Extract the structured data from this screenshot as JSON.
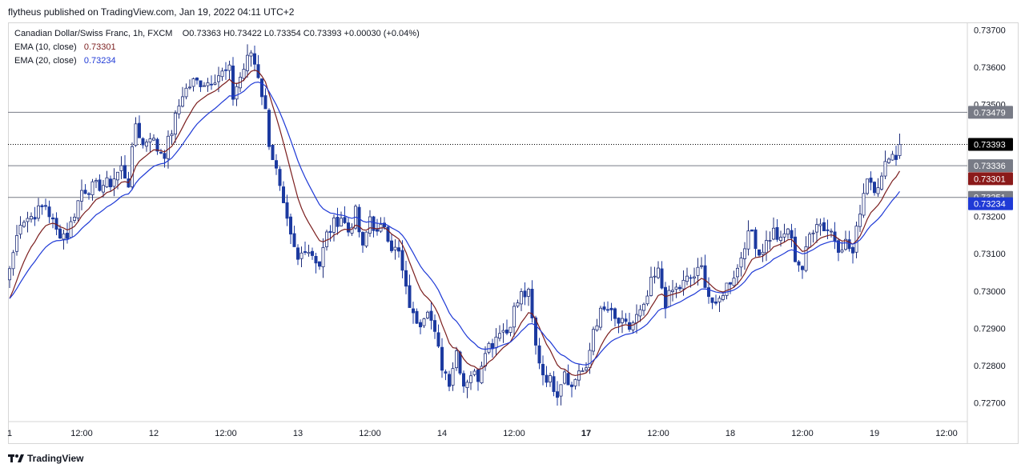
{
  "header": {
    "publisher_line": "flytheus published on TradingView.com, Jan 19, 2022 04:11 UTC+2"
  },
  "legend": {
    "symbol": "Canadian Dollar/Swiss Franc, 1h, FXCM",
    "ohlc": "O0.73363 H0.73422 L0.73354 C0.73393 +0.00030 (+0.04%)",
    "ema10_label": "EMA (10, close)",
    "ema10_value": "0.73301",
    "ema20_label": "EMA (20, close)",
    "ema20_value": "0.73234"
  },
  "footer": {
    "brand": "TradingView"
  },
  "colors": {
    "bull_body": "#ffffff",
    "bull_border": "#1f2e7a",
    "bear": "#1c3aa0",
    "ema10": "#7b1e1e",
    "ema20": "#1f3ad6",
    "level_line": "#787b86"
  },
  "chart_data": {
    "type": "candlestick",
    "title": "",
    "xlabel": "",
    "ylabel": "",
    "ylim": [
      0.7265,
      0.7372
    ],
    "y_ticks": [
      "0.72700",
      "0.72800",
      "0.72900",
      "0.73000",
      "0.73100",
      "0.73200",
      "0.73300",
      "0.73400",
      "0.73500",
      "0.73600",
      "0.73700"
    ],
    "x_ticks": [
      {
        "label": "1",
        "bar": 0
      },
      {
        "label": "12:00",
        "bar": 20
      },
      {
        "label": "12",
        "bar": 40
      },
      {
        "label": "12:00",
        "bar": 60
      },
      {
        "label": "13",
        "bar": 80
      },
      {
        "label": "12:00",
        "bar": 100
      },
      {
        "label": "14",
        "bar": 120
      },
      {
        "label": "12:00",
        "bar": 140
      },
      {
        "label": "17",
        "bar": 160
      },
      {
        "label": "12:00",
        "bar": 180
      },
      {
        "label": "18",
        "bar": 200
      },
      {
        "label": "12:00",
        "bar": 220
      },
      {
        "label": "19",
        "bar": 240
      },
      {
        "label": "12:00",
        "bar": 260
      }
    ],
    "levels": [
      {
        "price": 0.73479,
        "label": "0.73479",
        "style": "solid"
      },
      {
        "price": 0.73336,
        "label": "0.73336",
        "style": "solid"
      },
      {
        "price": 0.73251,
        "label": "0.73251",
        "style": "solid"
      },
      {
        "price": 0.73393,
        "label": "0.73393",
        "style": "dotted"
      }
    ],
    "price_badges": [
      {
        "price": 0.73479,
        "label": "0.73479",
        "bg": "#787b86"
      },
      {
        "price": 0.73393,
        "label": "0.73393",
        "bg": "#000000"
      },
      {
        "price": 0.73336,
        "label": "0.73336",
        "bg": "#787b86"
      },
      {
        "price": 0.73301,
        "label": "0.73301",
        "bg": "#8b1a1a"
      },
      {
        "price": 0.73251,
        "label": "0.73251",
        "bg": "#787b86"
      },
      {
        "price": 0.73234,
        "label": "0.73234",
        "bg": "#1f3ad6"
      }
    ],
    "candle_count": 248,
    "close_anchors": [
      [
        0,
        0.7306
      ],
      [
        3,
        0.7319
      ],
      [
        6,
        0.732
      ],
      [
        10,
        0.7323
      ],
      [
        13,
        0.7316
      ],
      [
        16,
        0.7315
      ],
      [
        20,
        0.7327
      ],
      [
        24,
        0.7328
      ],
      [
        28,
        0.7329
      ],
      [
        31,
        0.7333
      ],
      [
        33,
        0.7329
      ],
      [
        35,
        0.7345
      ],
      [
        37,
        0.7339
      ],
      [
        39,
        0.7342
      ],
      [
        41,
        0.7338
      ],
      [
        43,
        0.7337
      ],
      [
        45,
        0.7343
      ],
      [
        48,
        0.7353
      ],
      [
        51,
        0.7356
      ],
      [
        55,
        0.7356
      ],
      [
        58,
        0.7358
      ],
      [
        61,
        0.7359
      ],
      [
        62,
        0.7352
      ],
      [
        63,
        0.7355
      ],
      [
        66,
        0.7362
      ],
      [
        67,
        0.7364
      ],
      [
        69,
        0.7358
      ],
      [
        71,
        0.7348
      ],
      [
        72,
        0.734
      ],
      [
        74,
        0.7332
      ],
      [
        76,
        0.7322
      ],
      [
        78,
        0.7314
      ],
      [
        80,
        0.7308
      ],
      [
        82,
        0.7312
      ],
      [
        84,
        0.731
      ],
      [
        86,
        0.7307
      ],
      [
        88,
        0.7315
      ],
      [
        90,
        0.7318
      ],
      [
        92,
        0.732
      ],
      [
        94,
        0.7316
      ],
      [
        96,
        0.7321
      ],
      [
        98,
        0.7311
      ],
      [
        100,
        0.732
      ],
      [
        102,
        0.7315
      ],
      [
        104,
        0.7318
      ],
      [
        106,
        0.7312
      ],
      [
        108,
        0.731
      ],
      [
        110,
        0.73
      ],
      [
        112,
        0.7293
      ],
      [
        114,
        0.7292
      ],
      [
        116,
        0.7296
      ],
      [
        118,
        0.7288
      ],
      [
        120,
        0.728
      ],
      [
        122,
        0.7276
      ],
      [
        124,
        0.7284
      ],
      [
        126,
        0.7275
      ],
      [
        128,
        0.7278
      ],
      [
        130,
        0.7277
      ],
      [
        132,
        0.7285
      ],
      [
        134,
        0.7286
      ],
      [
        136,
        0.729
      ],
      [
        138,
        0.7289
      ],
      [
        140,
        0.7295
      ],
      [
        142,
        0.7299
      ],
      [
        144,
        0.7299
      ],
      [
        146,
        0.7285
      ],
      [
        148,
        0.7278
      ],
      [
        150,
        0.7276
      ],
      [
        152,
        0.7273
      ],
      [
        154,
        0.7279
      ],
      [
        156,
        0.7274
      ],
      [
        158,
        0.7279
      ],
      [
        160,
        0.7278
      ],
      [
        162,
        0.729
      ],
      [
        164,
        0.7294
      ],
      [
        166,
        0.7295
      ],
      [
        168,
        0.7292
      ],
      [
        170,
        0.7291
      ],
      [
        172,
        0.729
      ],
      [
        174,
        0.7293
      ],
      [
        176,
        0.7295
      ],
      [
        178,
        0.7302
      ],
      [
        180,
        0.7305
      ],
      [
        182,
        0.7297
      ],
      [
        184,
        0.73
      ],
      [
        186,
        0.7301
      ],
      [
        188,
        0.7303
      ],
      [
        190,
        0.7304
      ],
      [
        192,
        0.7306
      ],
      [
        194,
        0.7299
      ],
      [
        196,
        0.7295
      ],
      [
        198,
        0.73
      ],
      [
        200,
        0.7303
      ],
      [
        202,
        0.7306
      ],
      [
        204,
        0.7313
      ],
      [
        206,
        0.7316
      ],
      [
        208,
        0.731
      ],
      [
        210,
        0.7313
      ],
      [
        212,
        0.7316
      ],
      [
        214,
        0.7313
      ],
      [
        216,
        0.7317
      ],
      [
        218,
        0.7309
      ],
      [
        220,
        0.7306
      ],
      [
        222,
        0.7315
      ],
      [
        224,
        0.7319
      ],
      [
        226,
        0.7317
      ],
      [
        228,
        0.7316
      ],
      [
        230,
        0.7312
      ],
      [
        232,
        0.7313
      ],
      [
        234,
        0.731
      ],
      [
        236,
        0.7322
      ],
      [
        238,
        0.7331
      ],
      [
        240,
        0.7328
      ],
      [
        242,
        0.733
      ],
      [
        244,
        0.7337
      ],
      [
        246,
        0.7336
      ],
      [
        247,
        0.73393
      ]
    ]
  }
}
